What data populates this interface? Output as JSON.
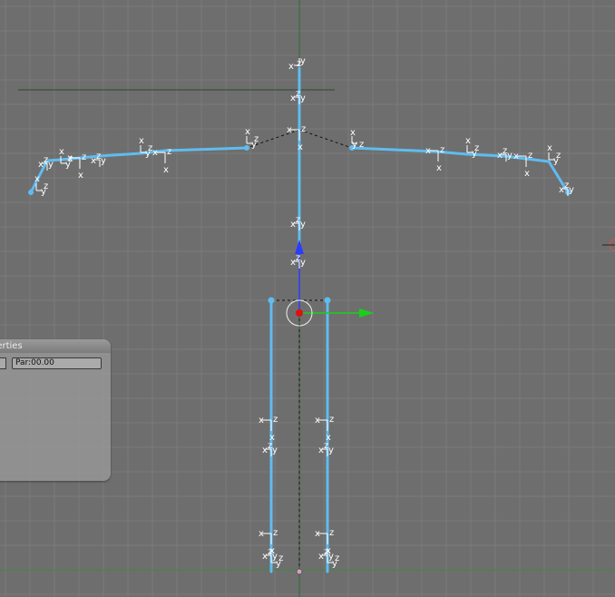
{
  "panel": {
    "title": "perties",
    "par_field": "Par:00.00"
  },
  "colors": {
    "background": "#6e6e6e",
    "bone": "#5fbcf0",
    "grid_minor": "#7a7a7a",
    "axis_x": "#3a8a3a",
    "axis_z": "#3a8a3a",
    "manip_x": "#19d019",
    "manip_y": "#2b3cff",
    "pivot": "#e01010"
  },
  "axis_labels": {
    "x": "x",
    "y": "y",
    "z": "z"
  }
}
